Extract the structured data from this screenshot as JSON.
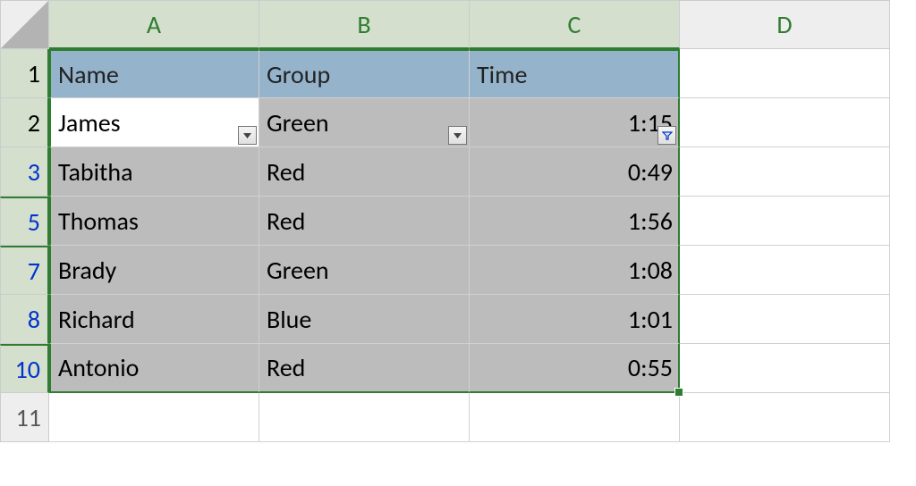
{
  "columns": [
    "A",
    "B",
    "C",
    "D"
  ],
  "headers": {
    "A": "Name",
    "B": "Group",
    "C": "Time"
  },
  "rows": [
    {
      "num": "1",
      "is_header": true,
      "filtered": false,
      "gap_above": false
    },
    {
      "num": "2",
      "A": "James",
      "B": "Green",
      "C": "1:15",
      "filtered": false,
      "gap_above": false,
      "active": true
    },
    {
      "num": "3",
      "A": "Tabitha",
      "B": "Red",
      "C": "0:49",
      "filtered": true,
      "gap_above": false
    },
    {
      "num": "5",
      "A": "Thomas",
      "B": "Red",
      "C": "1:56",
      "filtered": true,
      "gap_above": true
    },
    {
      "num": "7",
      "A": "Brady",
      "B": "Green",
      "C": "1:08",
      "filtered": true,
      "gap_above": true
    },
    {
      "num": "8",
      "A": "Richard",
      "B": "Blue",
      "C": "1:01",
      "filtered": true,
      "gap_above": false
    },
    {
      "num": "10",
      "A": "Antonio",
      "B": "Red",
      "C": "0:55",
      "filtered": true,
      "gap_above": true
    }
  ],
  "trailing_rows": [
    "11"
  ],
  "selection": {
    "first_col": "A",
    "last_col": "C"
  },
  "filter_columns": [
    "A",
    "B",
    "C"
  ],
  "filter_active_col": "C"
}
